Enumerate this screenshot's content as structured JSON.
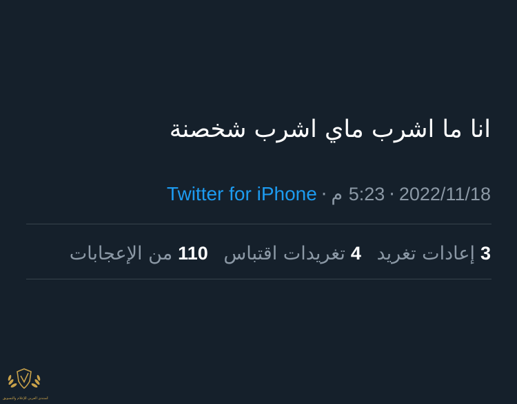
{
  "tweet": {
    "text": "انا ما اشرب ماي اشرب شخصنة",
    "date": "2022/11/18",
    "separator": "·",
    "time_value": "5:23",
    "time_suffix": "م",
    "source": "Twitter for iPhone"
  },
  "stats": [
    {
      "count": "3",
      "label": "إعادات تغريد"
    },
    {
      "count": "4",
      "label": "تغريدات اقتباس"
    },
    {
      "count": "110",
      "label": "من الإعجابات"
    }
  ],
  "watermark": {
    "icon": "laurel-shield-logo",
    "text": "المنتدى العربي للإعلام والتسويق"
  },
  "colors": {
    "background": "#15202b",
    "primary_text": "#ffffff",
    "secondary_text": "#8b98a5",
    "link": "#1d9bf0",
    "divider": "#38444d",
    "watermark_gold": "#c9a24a"
  }
}
